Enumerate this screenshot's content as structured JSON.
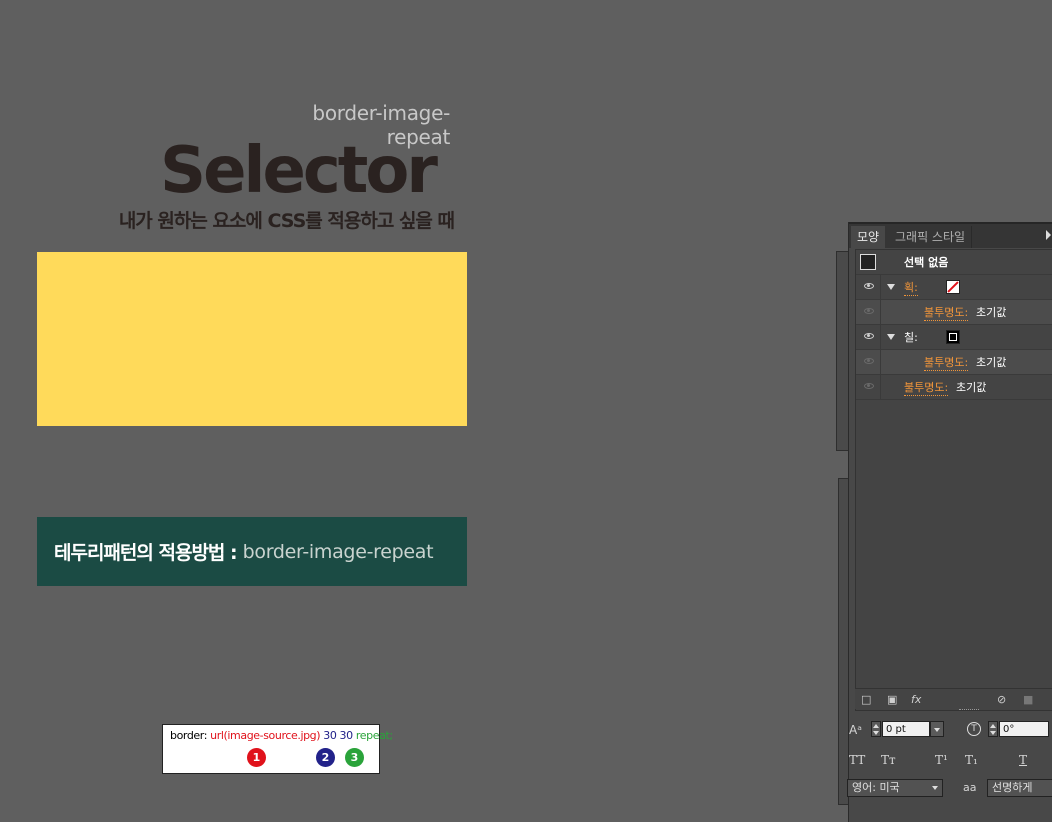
{
  "artboard": {
    "subtitle": "border-image-repeat",
    "title": "Selector",
    "tagline": "내가 원하는 요소에 CSS를 적용하고 싶을 때",
    "section": {
      "label": "테두리패턴의 적용방법 :",
      "value": "border-image-repeat"
    },
    "code": {
      "prop": "border:",
      "url": "url(image-source.jpg)",
      "nums": "30 30",
      "repeat": "repeat;",
      "badges": [
        "1",
        "2",
        "3"
      ]
    },
    "colors": {
      "yellow": "#ffda5a",
      "green": "#1b4b44",
      "badge1": "#e0121b",
      "badge2": "#22228a",
      "badge3": "#2aa33a"
    }
  },
  "appearance_panel": {
    "tabs": [
      "모양",
      "그래픽 스타일"
    ],
    "rows": [
      {
        "icon": "swatch-icon",
        "label": "선택 없음"
      },
      {
        "icon": "eye-icon",
        "label": "획:",
        "swatch": "none-swatch-icon"
      },
      {
        "icon": "eye-icon",
        "label": "불투명도:",
        "value": "초기값"
      },
      {
        "icon": "eye-icon",
        "label": "칠:",
        "swatch": "stroke-swatch-icon"
      },
      {
        "icon": "eye-icon",
        "label": "불투명도:",
        "value": "초기값"
      },
      {
        "icon": "eye-icon",
        "label": "불투명도:",
        "value": "초기값"
      }
    ],
    "footer": {
      "fx": "fx"
    }
  },
  "character_controls": {
    "baseline_value": "0 pt",
    "rotation_value": "0°",
    "type_buttons": [
      "TT",
      "Tт",
      "T¹",
      "T₁",
      "T"
    ],
    "language": "영어: 미국",
    "aa_label": "aa",
    "antialias": "선명하게"
  }
}
